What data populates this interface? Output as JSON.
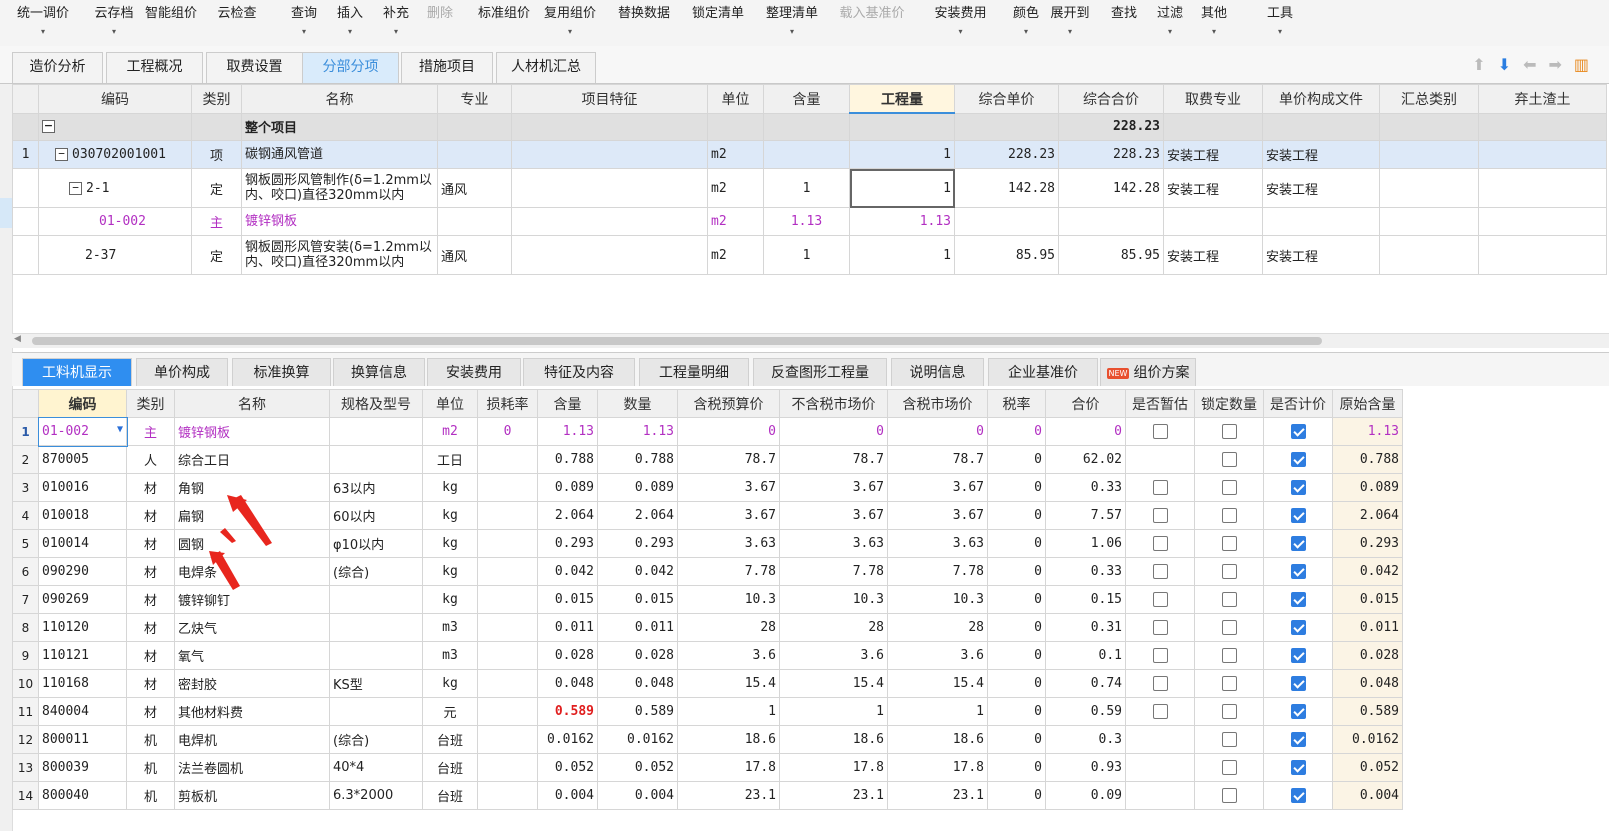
{
  "toolbar": {
    "items": [
      {
        "label": "统一调价",
        "dd": true,
        "disabled": false
      },
      {
        "label": "云存档",
        "dd": true,
        "disabled": false
      },
      {
        "label": "智能组价",
        "dd": false,
        "disabled": false
      },
      {
        "label": "云检查",
        "dd": false,
        "disabled": false
      },
      {
        "label": "查询",
        "dd": true,
        "disabled": false
      },
      {
        "label": "插入",
        "dd": true,
        "disabled": false
      },
      {
        "label": "补充",
        "dd": true,
        "disabled": false
      },
      {
        "label": "删除",
        "dd": false,
        "disabled": true
      },
      {
        "label": "标准组价",
        "dd": false,
        "disabled": false
      },
      {
        "label": "复用组价",
        "dd": true,
        "disabled": false
      },
      {
        "label": "替换数据",
        "dd": false,
        "disabled": false
      },
      {
        "label": "锁定清单",
        "dd": false,
        "disabled": false
      },
      {
        "label": "整理清单",
        "dd": true,
        "disabled": false
      },
      {
        "label": "载入基准价",
        "dd": false,
        "disabled": true
      },
      {
        "label": "安装费用",
        "dd": true,
        "disabled": false
      },
      {
        "label": "颜色",
        "dd": true,
        "disabled": false
      },
      {
        "label": "展开到",
        "dd": true,
        "disabled": false
      },
      {
        "label": "查找",
        "dd": false,
        "disabled": false
      },
      {
        "label": "过滤",
        "dd": true,
        "disabled": false
      },
      {
        "label": "其他",
        "dd": true,
        "disabled": false
      },
      {
        "label": "工具",
        "dd": true,
        "disabled": false
      }
    ]
  },
  "tabs": [
    "造价分析",
    "工程概况",
    "取费设置",
    "分部分项",
    "措施项目",
    "人材机汇总"
  ],
  "active_tab": "分部分项",
  "upper": {
    "headers": [
      "编码",
      "类别",
      "名称",
      "专业",
      "项目特征",
      "单位",
      "含量",
      "工程量",
      "综合单价",
      "综合合价",
      "取费专业",
      "单价构成文件",
      "汇总类别",
      "弃土渣土"
    ],
    "group": {
      "expander": "−",
      "name": "整个项目",
      "total": "228.23"
    },
    "rows": [
      {
        "no": "1",
        "code": "030702001001",
        "type": "项",
        "name": "碳钢通风管道",
        "spec": "",
        "feature": "",
        "unit": "m2",
        "qty": "",
        "amount": "1",
        "unit_price": "228.23",
        "total": "228.23",
        "fee": "安装工程",
        "file": "安装工程"
      },
      {
        "no": "",
        "code": "2-1",
        "type": "定",
        "name": "钢板圆形风管制作(δ=1.2mm以内、咬口)直径320mm以内",
        "spec": "通风",
        "feature": "",
        "unit": "m2",
        "qty": "1",
        "amount": "1",
        "unit_price": "142.28",
        "total": "142.28",
        "fee": "安装工程",
        "file": "安装工程"
      },
      {
        "no": "",
        "code": "01-002",
        "type": "主",
        "name": "镀锌钢板",
        "spec": "",
        "feature": "",
        "unit": "m2",
        "qty": "1.13",
        "amount": "1.13",
        "unit_price": "",
        "total": "",
        "fee": "",
        "file": ""
      },
      {
        "no": "",
        "code": "2-37",
        "type": "定",
        "name": "钢板圆形风管安装(δ=1.2mm以内、咬口)直径320mm以内",
        "spec": "通风",
        "feature": "",
        "unit": "m2",
        "qty": "1",
        "amount": "1",
        "unit_price": "85.95",
        "total": "85.95",
        "fee": "安装工程",
        "file": "安装工程"
      }
    ]
  },
  "lower_tabs": [
    "工料机显示",
    "单价构成",
    "标准换算",
    "换算信息",
    "安装费用",
    "特征及内容",
    "工程量明细",
    "反查图形工程量",
    "说明信息",
    "企业基准价",
    "组价方案"
  ],
  "lower_tab_badge": "NEW",
  "lower": {
    "headers": [
      "编码",
      "类别",
      "名称",
      "规格及型号",
      "单位",
      "损耗率",
      "含量",
      "数量",
      "含税预算价",
      "不含税市场价",
      "含税市场价",
      "税率",
      "合价",
      "是否暂估",
      "锁定数量",
      "是否计价",
      "原始含量"
    ],
    "rows": [
      {
        "no": "1",
        "code": "01-002",
        "type": "主",
        "name": "镀锌钢板",
        "spec": "",
        "unit": "m2",
        "loss": "0",
        "qty": "1.13",
        "amount": "1.13",
        "tax_budget": "0",
        "notax_market": "0",
        "tax_market": "0",
        "rate": "0",
        "total": "0",
        "est": false,
        "lock": false,
        "priced": true,
        "orig": "1.13",
        "purple": true
      },
      {
        "no": "2",
        "code": "870005",
        "type": "人",
        "name": "综合工日",
        "spec": "",
        "unit": "工日",
        "loss": "",
        "qty": "0.788",
        "amount": "0.788",
        "tax_budget": "78.7",
        "notax_market": "78.7",
        "tax_market": "78.7",
        "rate": "0",
        "total": "62.02",
        "est": null,
        "lock": false,
        "priced": true,
        "orig": "0.788"
      },
      {
        "no": "3",
        "code": "010016",
        "type": "材",
        "name": "角钢",
        "spec": "63以内",
        "unit": "kg",
        "loss": "",
        "qty": "0.089",
        "amount": "0.089",
        "tax_budget": "3.67",
        "notax_market": "3.67",
        "tax_market": "3.67",
        "rate": "0",
        "total": "0.33",
        "est": false,
        "lock": false,
        "priced": true,
        "orig": "0.089"
      },
      {
        "no": "4",
        "code": "010018",
        "type": "材",
        "name": "扁钢",
        "spec": "60以内",
        "unit": "kg",
        "loss": "",
        "qty": "2.064",
        "amount": "2.064",
        "tax_budget": "3.67",
        "notax_market": "3.67",
        "tax_market": "3.67",
        "rate": "0",
        "total": "7.57",
        "est": false,
        "lock": false,
        "priced": true,
        "orig": "2.064"
      },
      {
        "no": "5",
        "code": "010014",
        "type": "材",
        "name": "圆钢",
        "spec": "φ10以内",
        "unit": "kg",
        "loss": "",
        "qty": "0.293",
        "amount": "0.293",
        "tax_budget": "3.63",
        "notax_market": "3.63",
        "tax_market": "3.63",
        "rate": "0",
        "total": "1.06",
        "est": false,
        "lock": false,
        "priced": true,
        "orig": "0.293"
      },
      {
        "no": "6",
        "code": "090290",
        "type": "材",
        "name": "电焊条",
        "spec": "(综合)",
        "unit": "kg",
        "loss": "",
        "qty": "0.042",
        "amount": "0.042",
        "tax_budget": "7.78",
        "notax_market": "7.78",
        "tax_market": "7.78",
        "rate": "0",
        "total": "0.33",
        "est": false,
        "lock": false,
        "priced": true,
        "orig": "0.042"
      },
      {
        "no": "7",
        "code": "090269",
        "type": "材",
        "name": "镀锌铆钉",
        "spec": "",
        "unit": "kg",
        "loss": "",
        "qty": "0.015",
        "amount": "0.015",
        "tax_budget": "10.3",
        "notax_market": "10.3",
        "tax_market": "10.3",
        "rate": "0",
        "total": "0.15",
        "est": false,
        "lock": false,
        "priced": true,
        "orig": "0.015"
      },
      {
        "no": "8",
        "code": "110120",
        "type": "材",
        "name": "乙炔气",
        "spec": "",
        "unit": "m3",
        "loss": "",
        "qty": "0.011",
        "amount": "0.011",
        "tax_budget": "28",
        "notax_market": "28",
        "tax_market": "28",
        "rate": "0",
        "total": "0.31",
        "est": false,
        "lock": false,
        "priced": true,
        "orig": "0.011"
      },
      {
        "no": "9",
        "code": "110121",
        "type": "材",
        "name": "氧气",
        "spec": "",
        "unit": "m3",
        "loss": "",
        "qty": "0.028",
        "amount": "0.028",
        "tax_budget": "3.6",
        "notax_market": "3.6",
        "tax_market": "3.6",
        "rate": "0",
        "total": "0.1",
        "est": false,
        "lock": false,
        "priced": true,
        "orig": "0.028"
      },
      {
        "no": "10",
        "code": "110168",
        "type": "材",
        "name": "密封胶",
        "spec": "KS型",
        "unit": "kg",
        "loss": "",
        "qty": "0.048",
        "amount": "0.048",
        "tax_budget": "15.4",
        "notax_market": "15.4",
        "tax_market": "15.4",
        "rate": "0",
        "total": "0.74",
        "est": false,
        "lock": false,
        "priced": true,
        "orig": "0.048"
      },
      {
        "no": "11",
        "code": "840004",
        "type": "材",
        "name": "其他材料费",
        "spec": "",
        "unit": "元",
        "loss": "",
        "qty": "0.589",
        "amount": "0.589",
        "tax_budget": "1",
        "notax_market": "1",
        "tax_market": "1",
        "rate": "0",
        "total": "0.59",
        "est": false,
        "lock": false,
        "priced": true,
        "orig": "0.589",
        "red": true
      },
      {
        "no": "12",
        "code": "800011",
        "type": "机",
        "name": "电焊机",
        "spec": "(综合)",
        "unit": "台班",
        "loss": "",
        "qty": "0.0162",
        "amount": "0.0162",
        "tax_budget": "18.6",
        "notax_market": "18.6",
        "tax_market": "18.6",
        "rate": "0",
        "total": "0.3",
        "est": null,
        "lock": false,
        "priced": true,
        "orig": "0.0162"
      },
      {
        "no": "13",
        "code": "800039",
        "type": "机",
        "name": "法兰卷圆机",
        "spec": "40*4",
        "unit": "台班",
        "loss": "",
        "qty": "0.052",
        "amount": "0.052",
        "tax_budget": "17.8",
        "notax_market": "17.8",
        "tax_market": "17.8",
        "rate": "0",
        "total": "0.93",
        "est": null,
        "lock": false,
        "priced": true,
        "orig": "0.052"
      },
      {
        "no": "14",
        "code": "800040",
        "type": "机",
        "name": "剪板机",
        "spec": "6.3*2000",
        "unit": "台班",
        "loss": "",
        "qty": "0.004",
        "amount": "0.004",
        "tax_budget": "23.1",
        "notax_market": "23.1",
        "tax_market": "23.1",
        "rate": "0",
        "total": "0.09",
        "est": null,
        "lock": false,
        "priced": true,
        "orig": "0.004"
      }
    ]
  },
  "colors": {
    "accent": "#2f8ef0",
    "purple": "#b22fc2",
    "red": "#e01e1e",
    "annotation": "#e8261e"
  },
  "icons": [
    "arrow-up-icon",
    "arrow-down-icon",
    "arrow-left-icon",
    "arrow-right-icon",
    "settings-icon"
  ]
}
